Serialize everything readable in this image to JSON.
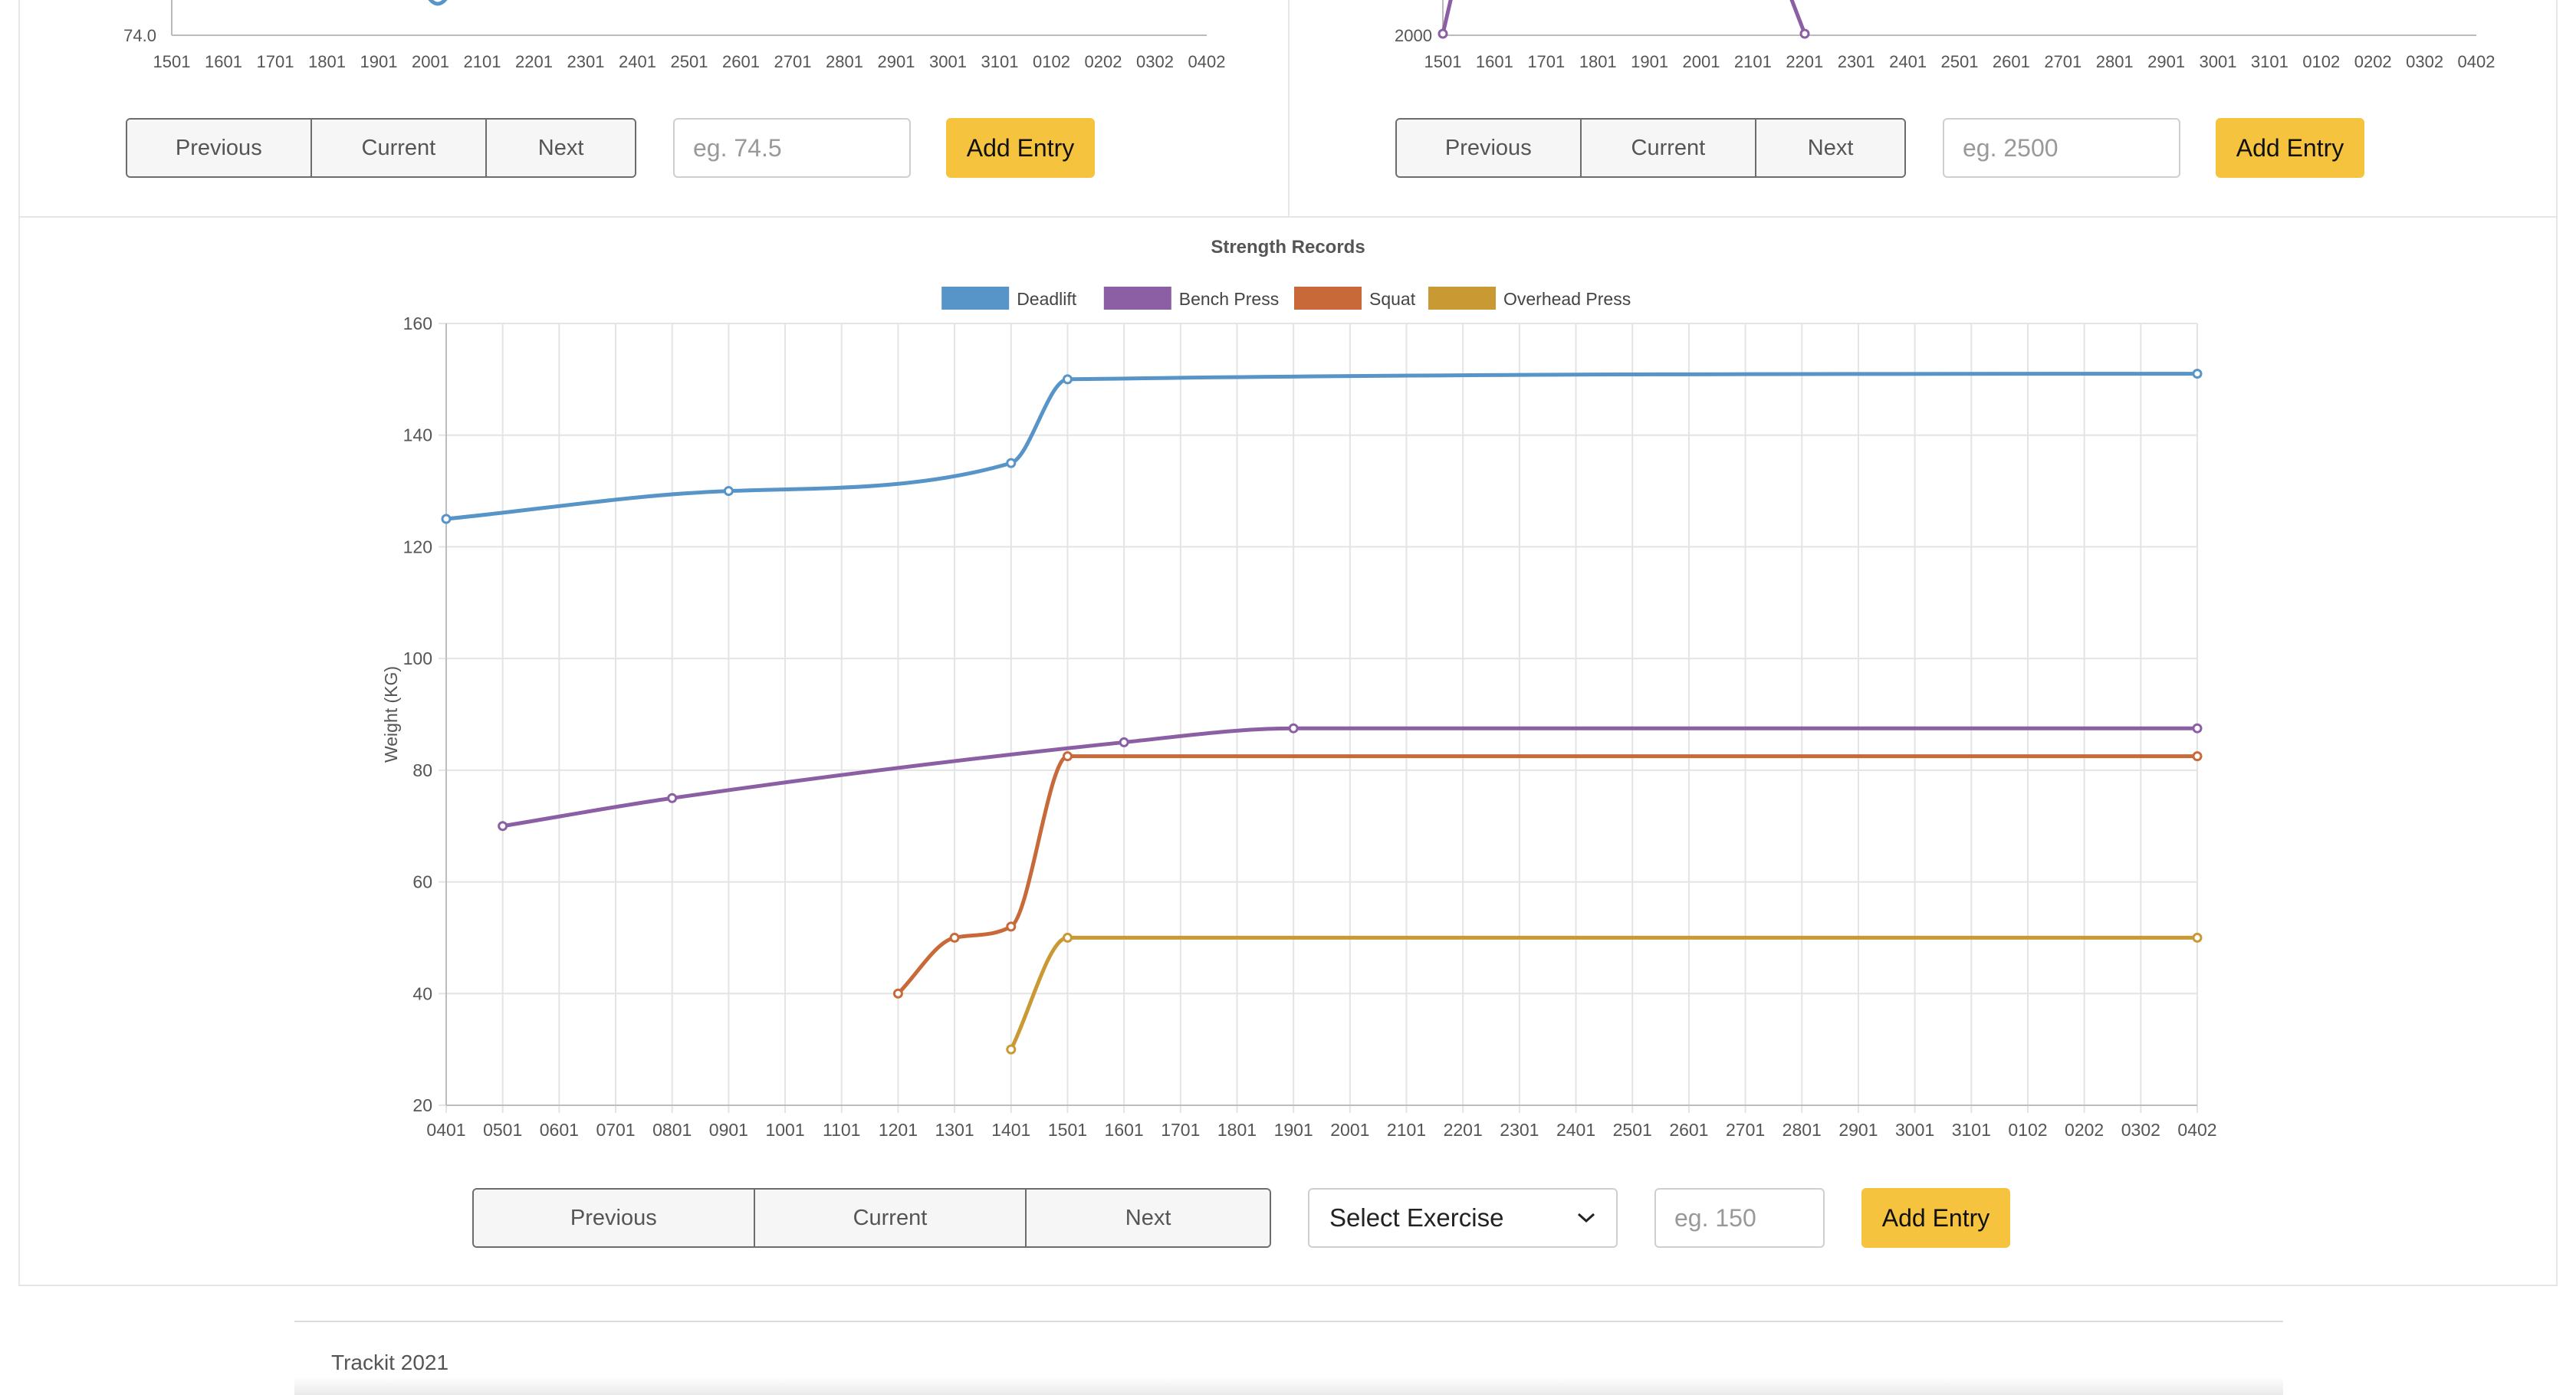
{
  "weight": {
    "y_min_label": "74.0",
    "x_labels": [
      "1501",
      "1601",
      "1701",
      "1801",
      "1901",
      "2001",
      "2101",
      "2201",
      "2301",
      "2401",
      "2501",
      "2601",
      "2701",
      "2801",
      "2901",
      "3001",
      "3101",
      "0102",
      "0202",
      "0302",
      "0402"
    ],
    "previous_label": "Previous",
    "current_label": "Current",
    "next_label": "Next",
    "input_placeholder": "eg. 74.5",
    "add_label": "Add Entry"
  },
  "calories": {
    "y_min_label": "2000",
    "x_labels": [
      "1501",
      "1601",
      "1701",
      "1801",
      "1901",
      "2001",
      "2101",
      "2201",
      "2301",
      "2401",
      "2501",
      "2601",
      "2701",
      "2801",
      "2901",
      "3001",
      "3101",
      "0102",
      "0202",
      "0302",
      "0402"
    ],
    "previous_label": "Previous",
    "current_label": "Current",
    "next_label": "Next",
    "input_placeholder": "eg. 2500",
    "add_label": "Add Entry"
  },
  "strength": {
    "previous_label": "Previous",
    "current_label": "Current",
    "next_label": "Next",
    "select_label": "Select Exercise",
    "input_placeholder": "eg. 150",
    "add_label": "Add Entry"
  },
  "chart_data": {
    "type": "line",
    "title": "Strength Records",
    "xlabel": "",
    "ylabel": "Weight (KG)",
    "ylim": [
      20,
      160
    ],
    "yticks": [
      20,
      40,
      60,
      80,
      100,
      120,
      140,
      160
    ],
    "grid": true,
    "legend_position": "top-center",
    "categories": [
      "0401",
      "0501",
      "0601",
      "0701",
      "0801",
      "0901",
      "1001",
      "1101",
      "1201",
      "1301",
      "1401",
      "1501",
      "1601",
      "1701",
      "1801",
      "1901",
      "2001",
      "2101",
      "2201",
      "2301",
      "2401",
      "2501",
      "2601",
      "2701",
      "2801",
      "2901",
      "3001",
      "3101",
      "0102",
      "0202",
      "0302",
      "0402"
    ],
    "series": [
      {
        "name": "Deadlift",
        "color": "#5794c8",
        "points": [
          {
            "i": 0,
            "y": 125
          },
          {
            "i": 5,
            "y": 130
          },
          {
            "i": 10,
            "y": 135
          },
          {
            "i": 11,
            "y": 150
          },
          {
            "i": 31,
            "y": 151
          }
        ]
      },
      {
        "name": "Bench Press",
        "color": "#8c5ea4",
        "points": [
          {
            "i": 1,
            "y": 70
          },
          {
            "i": 4,
            "y": 75
          },
          {
            "i": 12,
            "y": 85
          },
          {
            "i": 15,
            "y": 87.5
          },
          {
            "i": 31,
            "y": 87.5
          }
        ]
      },
      {
        "name": "Squat",
        "color": "#c8693a",
        "points": [
          {
            "i": 8,
            "y": 40
          },
          {
            "i": 9,
            "y": 50
          },
          {
            "i": 10,
            "y": 52
          },
          {
            "i": 11,
            "y": 82.5
          },
          {
            "i": 31,
            "y": 82.5
          }
        ]
      },
      {
        "name": "Overhead Press",
        "color": "#c99a34",
        "points": [
          {
            "i": 10,
            "y": 30
          },
          {
            "i": 11,
            "y": 50
          },
          {
            "i": 31,
            "y": 50
          }
        ]
      }
    ]
  }
}
